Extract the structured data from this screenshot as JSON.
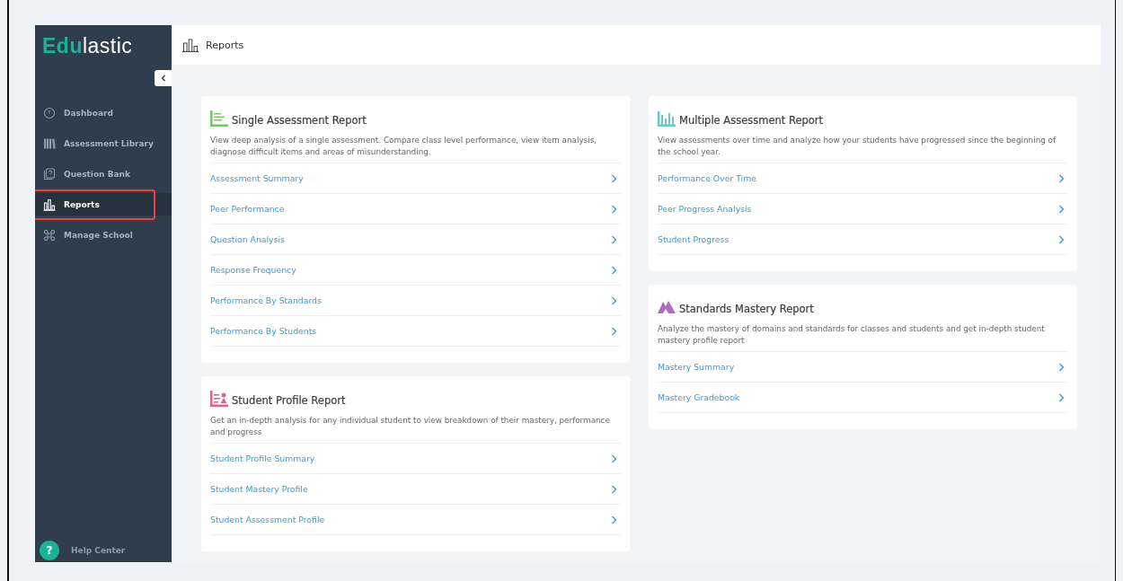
{
  "logo": {
    "accent": "Edu",
    "rest": "lastic"
  },
  "sidebar": {
    "items": [
      {
        "label": "Dashboard",
        "kind": "clock",
        "selected": false,
        "highlighted": false
      },
      {
        "label": "Assessment Library",
        "kind": "books",
        "selected": false,
        "highlighted": false
      },
      {
        "label": "Question Bank",
        "kind": "question",
        "selected": false,
        "highlighted": false
      },
      {
        "label": "Reports",
        "kind": "bars",
        "selected": true,
        "highlighted": true
      },
      {
        "label": "Manage School",
        "kind": "command",
        "selected": false,
        "highlighted": false
      }
    ],
    "help": {
      "glyph": "?",
      "label": "Help Center"
    }
  },
  "header": {
    "title": "Reports"
  },
  "columns": [
    [
      {
        "kind": "single",
        "color": "#7cc36b",
        "title": "Single Assessment Report",
        "description": "View deep analysis of a single assessment. Compare class level performance, view item analysis, diagnose difficult items and areas of misunderstanding.",
        "links": [
          "Assessment Summary",
          "Peer Performance",
          "Question Analysis",
          "Response Frequency",
          "Performance By Standards",
          "Performance By Students"
        ]
      },
      {
        "kind": "student",
        "color": "#d9668f",
        "title": "Student Profile Report",
        "description": "Get an in-depth analysis for any individual student to view breakdown of their mastery, performance and progress",
        "links": [
          "Student Profile Summary",
          "Student Mastery Profile",
          "Student Assessment Profile"
        ]
      }
    ],
    [
      {
        "kind": "multiple",
        "color": "#6cc7c9",
        "title": "Multiple Assessment Report",
        "description": "View assessments over time and analyze how your students have progressed since the beginning of the school year.",
        "links": [
          "Performance Over Time",
          "Peer Progress Analysis",
          "Student Progress"
        ]
      },
      {
        "kind": "standards",
        "color": "#b06cc4",
        "title": "Standards Mastery Report",
        "description": "Analyze the mastery of domains and standards for classes and students and get in-depth student mastery profile report",
        "links": [
          "Mastery Summary",
          "Mastery Gradebook"
        ]
      }
    ]
  ]
}
